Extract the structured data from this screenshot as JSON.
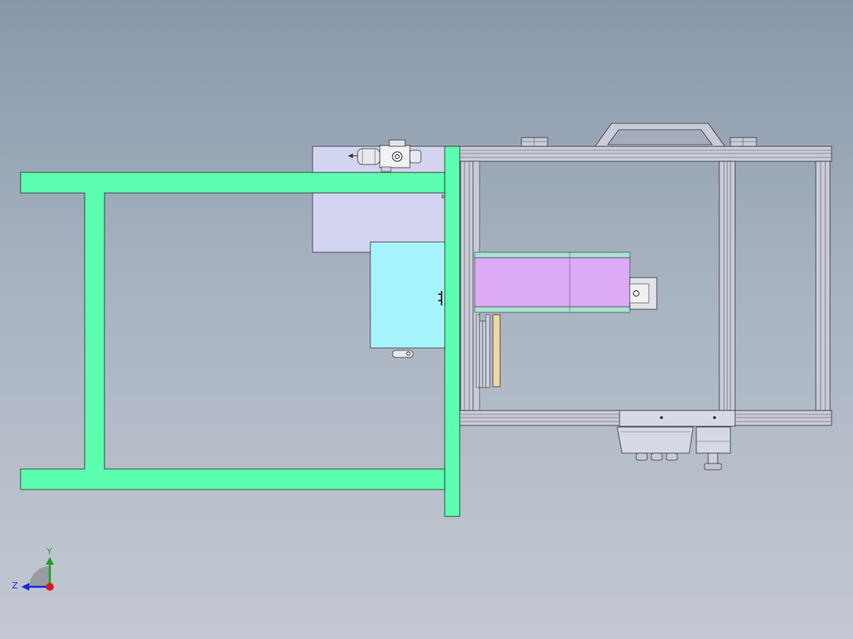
{
  "viewport": {
    "background_top": "#8898ab",
    "background_bottom": "#c4c9d2"
  },
  "colors": {
    "base_frame": "#5cffb0",
    "frame_outline": "#1c2a22",
    "housing": "#d2d4f0",
    "cyan_box": "#a6f4fb",
    "conveyor_belt": "#dcaaf7",
    "conveyor_rail": "#a9e2d6",
    "aluminum_profile": "#c9ccd8",
    "tan_plate": "#f3d8a6",
    "triad_x": "#e01818",
    "triad_y": "#1aa11a",
    "triad_z": "#1a2ad8"
  },
  "axis_triad": {
    "x_label": "",
    "y_label": "Y",
    "z_label": "Z",
    "icon": "coordinate-triad-icon"
  },
  "components": [
    "green-base-frame",
    "upper-housing",
    "cyan-box",
    "aluminum-outer-frame",
    "carry-handle",
    "hinge-left",
    "hinge-right",
    "conveyor-module",
    "cylinder-end-cap",
    "lower-mount-plate",
    "connector-block",
    "sensor-plug",
    "motor-actuator",
    "fitting-small",
    "slide-rails",
    "tan-plate"
  ]
}
